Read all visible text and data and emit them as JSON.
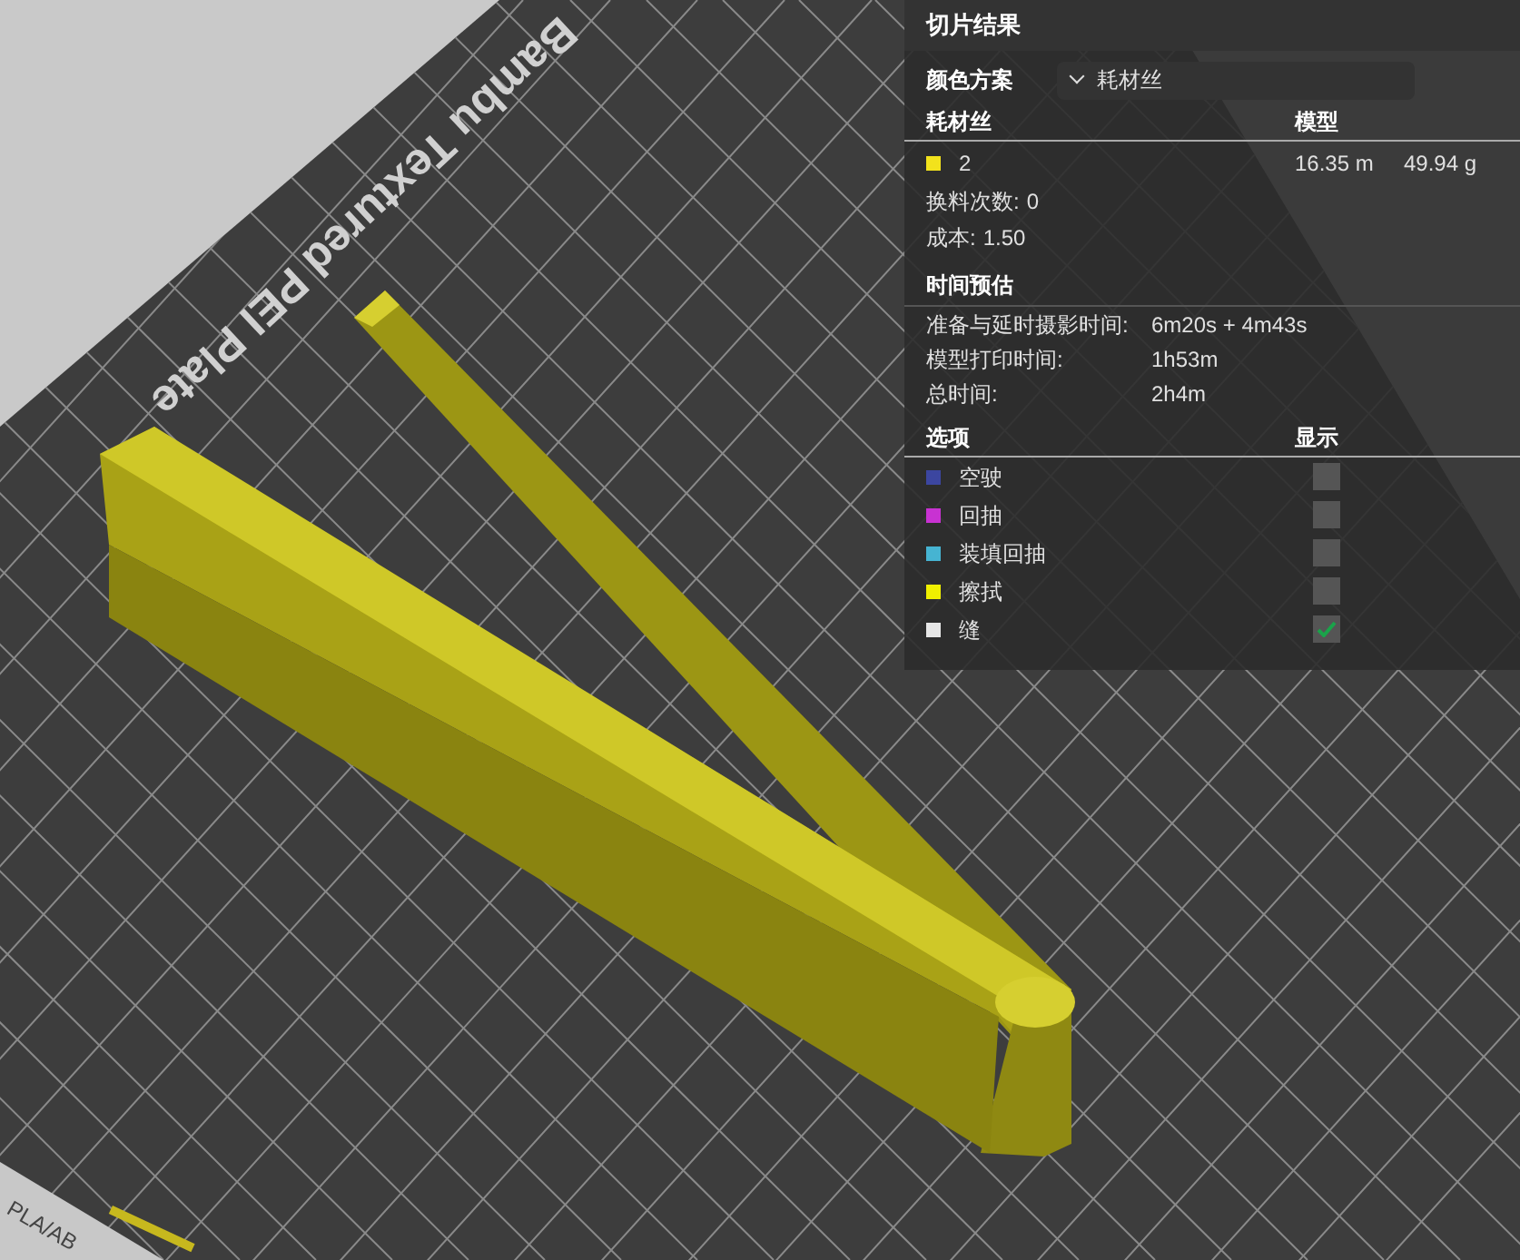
{
  "viewport": {
    "plate_label": "Bambu Textured PEI Plate",
    "corner_label": "PLA/AB"
  },
  "panel": {
    "title": "切片结果",
    "color_scheme": {
      "label": "颜色方案",
      "value": "耗材丝"
    },
    "filament_table": {
      "columns": [
        "耗材丝",
        "模型"
      ],
      "rows": [
        {
          "color": "#f2e21c",
          "name": "2",
          "length": "16.35 m",
          "weight": "49.94 g"
        }
      ]
    },
    "stats": [
      {
        "label": "换料次数:",
        "value": "0"
      },
      {
        "label": "成本:",
        "value": "1.50"
      }
    ],
    "time": {
      "title": "时间预估",
      "rows": [
        {
          "label": "准备与延时摄影时间:",
          "value": "6m20s + 4m43s"
        },
        {
          "label": "模型打印时间:",
          "value": "1h53m"
        },
        {
          "label": "总时间:",
          "value": "2h4m"
        }
      ]
    },
    "options": {
      "columns": [
        "选项",
        "显示"
      ],
      "items": [
        {
          "name": "空驶",
          "color": "#3c46a0",
          "checked": false
        },
        {
          "name": "回抽",
          "color": "#c832d2",
          "checked": false
        },
        {
          "name": "装填回抽",
          "color": "#46b4d2",
          "checked": false
        },
        {
          "name": "擦拭",
          "color": "#f0f000",
          "checked": false
        },
        {
          "name": "缝",
          "color": "#e6e6e6",
          "checked": true
        }
      ]
    }
  }
}
